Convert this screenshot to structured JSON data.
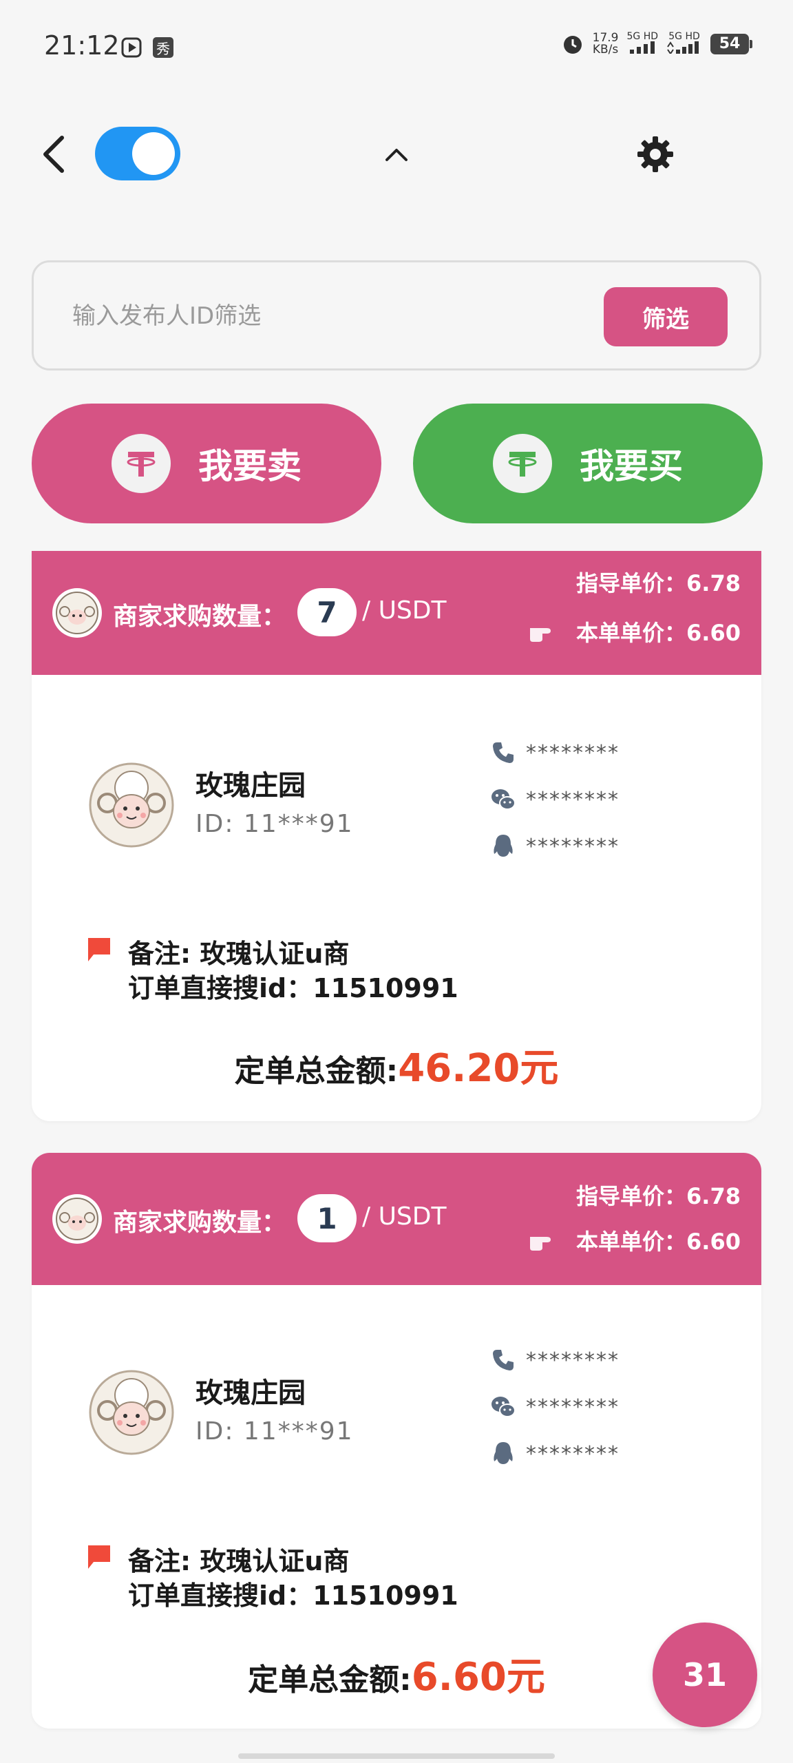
{
  "status_bar": {
    "time": "21:12",
    "net_speed_value": "17.9",
    "net_speed_unit": "KB/s",
    "signal_1": "5G HD",
    "signal_2": "5G HD",
    "battery": "54",
    "app_badge": "秀"
  },
  "search": {
    "placeholder": "输入发布人ID筛选",
    "filter_label": "筛选"
  },
  "actions": {
    "sell_label": "我要卖",
    "buy_label": "我要买"
  },
  "orders": [
    {
      "head_label": "商家求购数量：",
      "quantity": "7",
      "unit": "/ USDT",
      "guide_price": "指导单价：6.78",
      "order_price": "本单单价：6.60",
      "seller_name": "玫瑰庄园",
      "seller_id": "ID: 11***91",
      "phone": "********",
      "wechat": "********",
      "qq": "********",
      "note": "备注: 玫瑰认证u商",
      "search_id": "订单直接搜id：11510991",
      "total_label": "定单总金额:",
      "total_amount": "46.20元"
    },
    {
      "head_label": "商家求购数量：",
      "quantity": "1",
      "unit": "/ USDT",
      "guide_price": "指导单价：6.78",
      "order_price": "本单单价：6.60",
      "seller_name": "玫瑰庄园",
      "seller_id": "ID: 11***91",
      "phone": "********",
      "wechat": "********",
      "qq": "********",
      "note": "备注: 玫瑰认证u商",
      "search_id": "订单直接搜id：11510991",
      "total_label": "定单总金额:",
      "total_amount": "6.60元"
    }
  ],
  "fab_label": "31",
  "colors": {
    "brand_pink": "#d65384",
    "buy_green": "#4caf50",
    "toggle_blue": "#2196f3",
    "amount_red": "#e84a2a"
  }
}
